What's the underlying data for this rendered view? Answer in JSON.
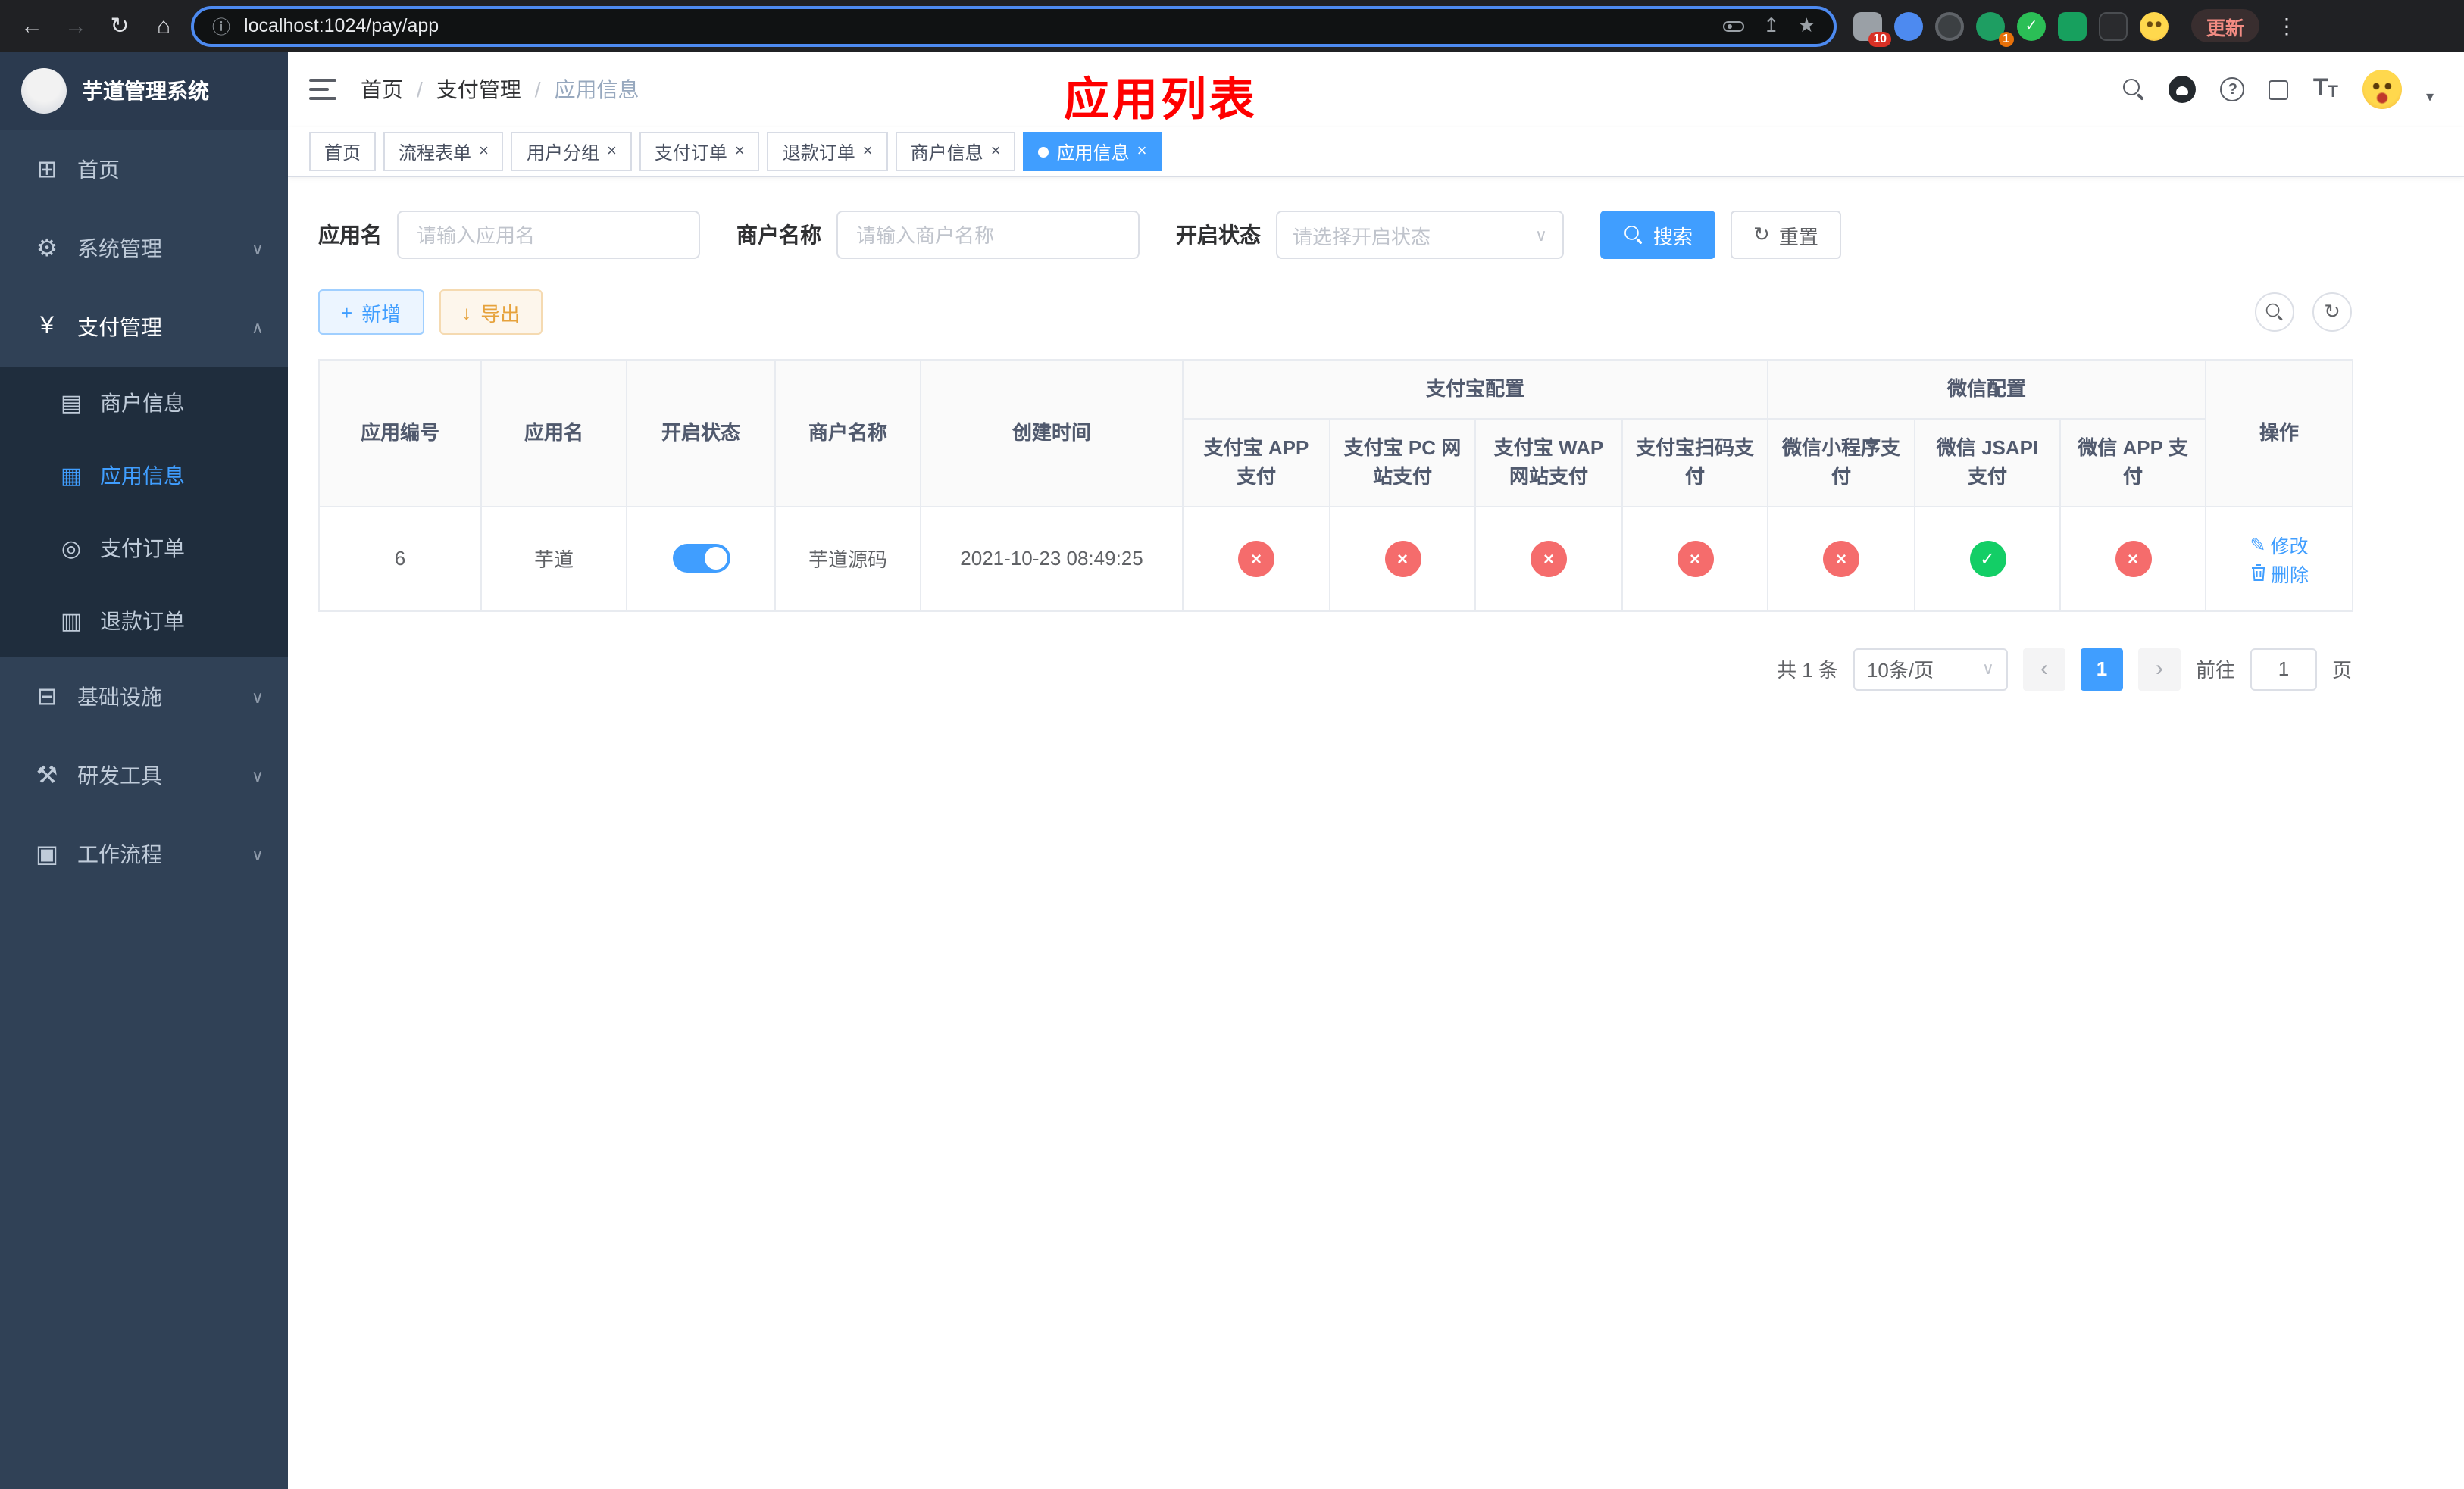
{
  "colors": {
    "accent": "#409eff",
    "danger": "#f56c6c",
    "success": "#13ce66",
    "warning": "#e6a23c",
    "annotation_red": "#ff0000",
    "sidebar_bg": "#304156",
    "submenu_bg": "#1f2d3d"
  },
  "icons": {
    "back": "←",
    "forward": "→",
    "reload": "↻",
    "home": "⌂",
    "info": "ⓘ",
    "share": "↥",
    "star": "★",
    "more": "⋮",
    "check": "✓",
    "cross": "×",
    "close": "×",
    "chevron_down": "∨",
    "chevron_up": "∧",
    "caret_down": "▾",
    "dashboard": "⊞",
    "gear": "⚙",
    "yen": "¥",
    "merchant": "▤",
    "app": "▦",
    "order": "◎",
    "refund": "▥",
    "infra": "⊟",
    "tools": "⚒",
    "workflow": "▣",
    "plus": "+",
    "download": "↓",
    "edit": "✎",
    "prev": "‹",
    "next": "›",
    "question": "?",
    "font_size_large": "T",
    "font_size_small": "T",
    "crumb_sep": "/",
    "ext_check": "✓"
  },
  "browser": {
    "url": "localhost:1024/pay/app",
    "update_label": "更新",
    "puzzle_badge": "10",
    "avatar_badge": "1"
  },
  "sidebar": {
    "logo_title": "芋道管理系统",
    "items": [
      {
        "label": "首页"
      },
      {
        "label": "系统管理"
      },
      {
        "label": "支付管理"
      },
      {
        "label": "基础设施"
      },
      {
        "label": "研发工具"
      },
      {
        "label": "工作流程"
      }
    ],
    "pay_children": [
      {
        "label": "商户信息"
      },
      {
        "label": "应用信息"
      },
      {
        "label": "支付订单"
      },
      {
        "label": "退款订单"
      }
    ]
  },
  "header": {
    "breadcrumb": [
      "首页",
      "支付管理",
      "应用信息"
    ],
    "annotation": "应用列表"
  },
  "tabs": [
    {
      "label": "首页"
    },
    {
      "label": "流程表单"
    },
    {
      "label": "用户分组"
    },
    {
      "label": "支付订单"
    },
    {
      "label": "退款订单"
    },
    {
      "label": "商户信息"
    },
    {
      "label": "应用信息"
    }
  ],
  "filters": {
    "app_name_label": "应用名",
    "app_name_placeholder": "请输入应用名",
    "merchant_label": "商户名称",
    "merchant_placeholder": "请输入商户名称",
    "status_label": "开启状态",
    "status_placeholder": "请选择开启状态",
    "search_label": "搜索",
    "reset_label": "重置"
  },
  "toolbar": {
    "add_label": "新增",
    "export_label": "导出"
  },
  "table": {
    "headers": [
      "应用编号",
      "应用名",
      "开启状态",
      "商户名称",
      "创建时间"
    ],
    "alipay_group": "支付宝配置",
    "wechat_group": "微信配置",
    "alipay_cols": [
      "支付宝 APP 支付",
      "支付宝 PC 网站支付",
      "支付宝 WAP 网站支付",
      "支付宝扫码支付"
    ],
    "wechat_cols": [
      "微信小程序支付",
      "微信 JSAPI 支付",
      "微信 APP 支付"
    ],
    "actions_header": "操作",
    "row": {
      "id": "6",
      "name": "芋道",
      "enabled": true,
      "merchant": "芋道源码",
      "created_at": "2021-10-23 08:49:25",
      "configs": [
        false,
        false,
        false,
        false,
        false,
        true,
        false
      ],
      "edit": "修改",
      "delete": "删除"
    }
  },
  "pagination": {
    "total": "共 1 条",
    "page_size": "10条/页",
    "page": "1",
    "goto_label": "前往",
    "goto_value": "1",
    "unit_label": "页"
  }
}
